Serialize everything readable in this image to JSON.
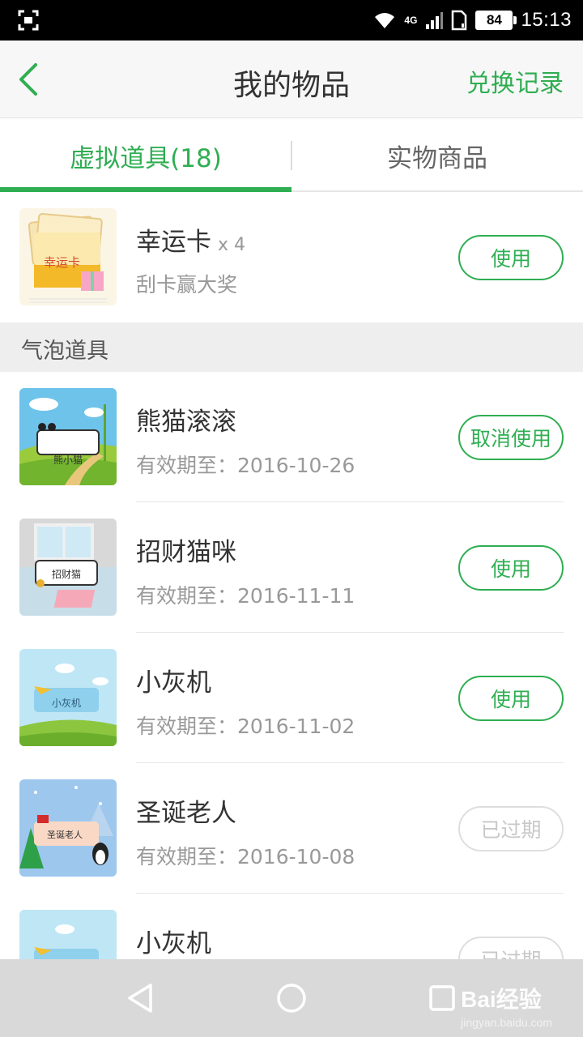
{
  "status_bar": {
    "network": "4G",
    "battery": "84",
    "time": "15:13"
  },
  "header": {
    "title": "我的物品",
    "action": "兑换记录"
  },
  "tabs": [
    {
      "label": "虚拟道具(18)",
      "active": true
    },
    {
      "label": "实物商品",
      "active": false
    }
  ],
  "top_item": {
    "title": "幸运卡",
    "quantity": "x 4",
    "subtitle": "刮卡赢大奖",
    "thumb_label": "幸运卡",
    "button": "使用"
  },
  "section": {
    "title": "气泡道具"
  },
  "bubble_items": [
    {
      "title": "熊猫滚滚",
      "expiry": "有效期至：2016-10-26",
      "thumb_label": "熊小猫",
      "button": "取消使用",
      "state": "active"
    },
    {
      "title": "招财猫咪",
      "expiry": "有效期至：2016-11-11",
      "thumb_label": "招财猫",
      "button": "使用",
      "state": "normal"
    },
    {
      "title": "小灰机",
      "expiry": "有效期至：2016-11-02",
      "thumb_label": "小灰机",
      "button": "使用",
      "state": "normal"
    },
    {
      "title": "圣诞老人",
      "expiry": "有效期至：2016-10-08",
      "thumb_label": "圣诞老人",
      "button": "已过期",
      "state": "expired"
    },
    {
      "title": "小灰机",
      "expiry": "",
      "thumb_label": "",
      "button": "已过期",
      "state": "expired"
    }
  ],
  "watermark": {
    "main": "Bai经验",
    "sub": "jingyan.baidu.com"
  },
  "colors": {
    "accent": "#2fae52",
    "disabled": "#c8c8c8",
    "section_bg": "#eeeeee"
  }
}
